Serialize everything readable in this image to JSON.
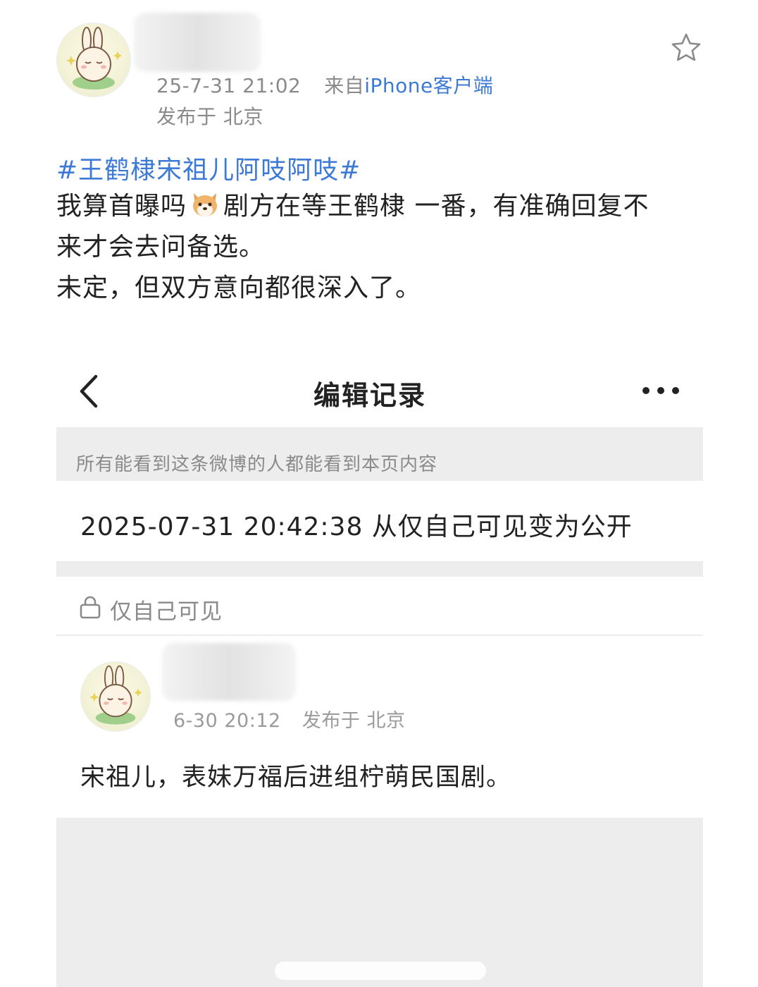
{
  "post": {
    "avatar_icon": "bunny-avatar-icon",
    "timestamp": "25-7-31 21:02",
    "source_prefix": "来自",
    "source_client": "iPhone客户端",
    "location": "发布于 北京",
    "favorite_icon": "star-outline-icon",
    "topic": "#王鹤棣宋祖儿阿吱阿吱#",
    "line1_before_emoji": "我算首曝吗",
    "emoji": "dog-face-emoji",
    "line1_after_emoji": "剧方在等王鹤棣 一番，有准确回复不",
    "line2": "来才会去问备选。",
    "line3": "未定，但双方意向都很深入了。"
  },
  "edit_history": {
    "title": "编辑记录",
    "back_icon": "chevron-left-icon",
    "more_icon": "more-dots-icon",
    "notice": "所有能看到这条微博的人都能看到本页内容",
    "change": "2025-07-31 20:42:38 从仅自己可见变为公开",
    "visibility_icon": "lock-icon",
    "visibility_label": "仅自己可见",
    "original": {
      "timestamp": "6-30 20:12",
      "location": "发布于 北京",
      "text": "宋祖儿，表妹万福后进组柠萌民国剧。"
    }
  },
  "colors": {
    "link_blue": "#3d7ad6",
    "gray_text": "#8a8a8a",
    "panel_gray": "#ededed"
  }
}
